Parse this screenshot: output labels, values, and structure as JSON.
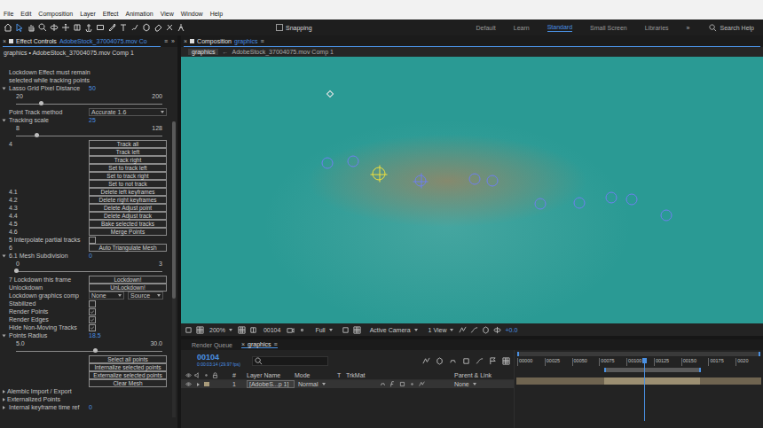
{
  "menu": [
    "File",
    "Edit",
    "Composition",
    "Layer",
    "Effect",
    "Animation",
    "View",
    "Window",
    "Help"
  ],
  "toolbar": {
    "snapping": {
      "label": "Snapping",
      "checked": false
    },
    "workspaces": [
      {
        "label": "Default",
        "selected": false
      },
      {
        "label": "Learn",
        "selected": false
      },
      {
        "label": "Standard",
        "selected": true
      },
      {
        "label": "Small Screen",
        "selected": false
      },
      {
        "label": "Libraries",
        "selected": false
      }
    ],
    "overflow": "»",
    "search": {
      "placeholder": "Search Help"
    }
  },
  "effect_controls": {
    "close_glyph": "×",
    "tab_label": "Effect Controls",
    "tab_target": "AdobeStock_37004075.mov Co",
    "menu_glyph": "≡",
    "overflow": "»",
    "subtitle": "graphics • AdobeStock_37004075.mov Comp 1",
    "params": [
      {
        "kind": "note",
        "label": "Lockdown Effect must remain"
      },
      {
        "kind": "note",
        "label": "selected while tracking points"
      },
      {
        "kind": "slider",
        "label": "Lasso Grid Pixel Distance",
        "value": "50",
        "min": "20",
        "max": "200",
        "level": 0.17,
        "expanded": true
      },
      {
        "kind": "dropdown",
        "label": "Point Track method",
        "value": "Accurate 1.6"
      },
      {
        "kind": "slider",
        "label": "Tracking scale",
        "value": "25",
        "min": "8",
        "max": "128",
        "level": 0.14,
        "expanded": true
      },
      {
        "kind": "button",
        "label": "4",
        "button": "Track all"
      },
      {
        "kind": "button",
        "label": "",
        "button": "Track left"
      },
      {
        "kind": "button",
        "label": "",
        "button": "Track right"
      },
      {
        "kind": "button",
        "label": "",
        "button": "Set to track left"
      },
      {
        "kind": "button",
        "label": "",
        "button": "Set to track right"
      },
      {
        "kind": "button",
        "label": "",
        "button": "Set to not track"
      },
      {
        "kind": "button",
        "label": "4.1",
        "button": "Delete left keyframes"
      },
      {
        "kind": "button",
        "label": "4.2",
        "button": "Delete right keyframes"
      },
      {
        "kind": "button",
        "label": "4.3",
        "button": "Delete Adjust point"
      },
      {
        "kind": "button",
        "label": "4.4",
        "button": "Delete Adjust track"
      },
      {
        "kind": "button",
        "label": "4.5",
        "button": "Bake selected tracks"
      },
      {
        "kind": "button",
        "label": "4.6",
        "button": "Merge Points"
      },
      {
        "kind": "checkbox",
        "label": "5 Interpolate partial tracks",
        "checked": false
      },
      {
        "kind": "button",
        "label": "6",
        "button": "Auto Triangulate Mesh"
      },
      {
        "kind": "slider",
        "label": "6.1 Mesh Subdivision",
        "value": "0",
        "min": "0",
        "max": "3",
        "level": 0.0,
        "expanded": true
      },
      {
        "kind": "button",
        "label": "7 Lockdown this frame",
        "button": "Lockdown!"
      },
      {
        "kind": "button",
        "label": "Unlockdown",
        "button": "UnLockdown!"
      },
      {
        "kind": "dropdowns",
        "label": "Lockdown graphics comp",
        "values": [
          "None",
          "Source"
        ]
      },
      {
        "kind": "checkbox",
        "label": "Stabilized",
        "checked": false
      },
      {
        "kind": "checkbox",
        "label": "Render Points",
        "checked": true
      },
      {
        "kind": "checkbox",
        "label": "Render Edges",
        "checked": true
      },
      {
        "kind": "checkbox",
        "label": "Hide Non-Moving Tracks",
        "checked": true
      },
      {
        "kind": "slider",
        "label": "Points Radius",
        "value": "18.5",
        "min": "5.0",
        "max": "30.0",
        "level": 0.54,
        "expanded": true
      },
      {
        "kind": "button",
        "label": "",
        "button": "Select all points"
      },
      {
        "kind": "button",
        "label": "",
        "button": "Internalize selected points"
      },
      {
        "kind": "button",
        "label": "",
        "button": "Externalize selected points"
      },
      {
        "kind": "button",
        "label": "",
        "button": "Clear Mesh"
      },
      {
        "kind": "group",
        "label": "Alembic Import / Export",
        "expanded": false
      },
      {
        "kind": "group",
        "label": "Externalized Points",
        "expanded": false
      },
      {
        "kind": "value",
        "label": "Internal keyframe time ref",
        "value": "0"
      }
    ]
  },
  "composition": {
    "close_glyph": "×",
    "tab_label": "Composition",
    "tab_target": "graphics",
    "menu_glyph": "≡",
    "breadcrumbs": [
      {
        "label": "graphics",
        "selected": true
      },
      {
        "label": "AdobeStock_37004075.mov Comp 1",
        "selected": false
      }
    ],
    "breadcrumb_separator": "←",
    "points": [
      {
        "kind": "diamond"
      },
      {
        "kind": "circle"
      },
      {
        "kind": "circle"
      },
      {
        "kind": "target"
      },
      {
        "kind": "crosshair"
      },
      {
        "kind": "circle"
      },
      {
        "kind": "circle"
      },
      {
        "kind": "circle"
      },
      {
        "kind": "circle"
      },
      {
        "kind": "circle"
      },
      {
        "kind": "circle"
      },
      {
        "kind": "circle"
      }
    ],
    "viewer_bar": {
      "zoom": "200%",
      "frame": "00104",
      "resolution": "Full",
      "camera": "Active Camera",
      "views": "1 View",
      "exposure": "+0.0"
    }
  },
  "timeline": {
    "tabs": [
      {
        "label": "Render Queue",
        "selected": false
      },
      {
        "label": "graphics",
        "selected": true
      }
    ],
    "close_glyph": "×",
    "menu_glyph": "≡",
    "timecode": "00104",
    "timecode_sub": "0:00:03:14 (29.97 fps)",
    "columns": [
      "#",
      "Layer Name",
      "Mode",
      "T",
      "TrkMat",
      "Parent & Link"
    ],
    "layers": [
      {
        "number": "1",
        "name": "[AdobeS...p 1]",
        "mode": "Normal",
        "parent": "None",
        "visible": true,
        "selected": true
      }
    ],
    "ruler": [
      "00000",
      "00025",
      "00050",
      "00075",
      "00100",
      "00125",
      "00150",
      "00175",
      "0020"
    ],
    "playhead": 0.52,
    "work_area": {
      "start": 0.36,
      "end": 0.75
    }
  }
}
